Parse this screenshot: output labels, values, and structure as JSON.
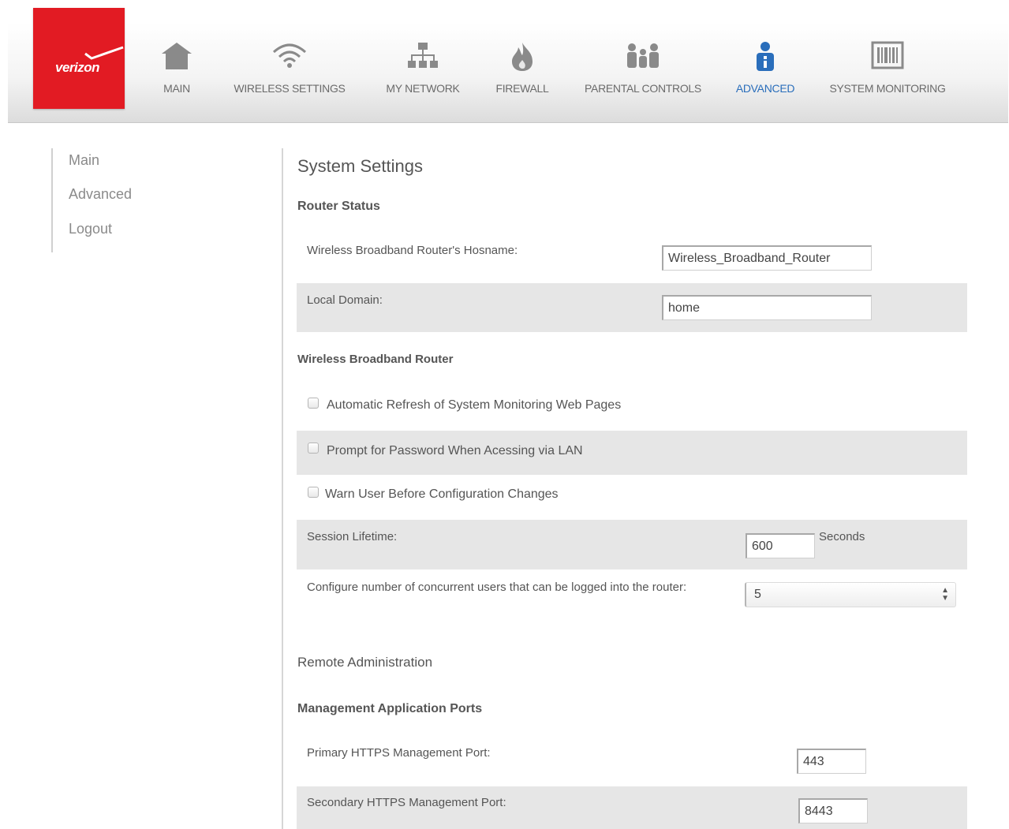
{
  "brand": {
    "logo_text": "verizon"
  },
  "nav": [
    {
      "label": "MAIN",
      "icon": "home-icon"
    },
    {
      "label": "WIRELESS SETTINGS",
      "icon": "wifi-icon"
    },
    {
      "label": "MY NETWORK",
      "icon": "network-icon"
    },
    {
      "label": "FIREWALL",
      "icon": "flame-icon"
    },
    {
      "label": "PARENTAL CONTROLS",
      "icon": "family-icon"
    },
    {
      "label": "ADVANCED",
      "icon": "advanced-user-icon",
      "active": true
    },
    {
      "label": "SYSTEM MONITORING",
      "icon": "monitor-icon"
    }
  ],
  "colors": {
    "brand_red": "#e21b23",
    "active_blue": "#2a6ebb"
  },
  "sidebar": {
    "items": [
      {
        "label": "Main"
      },
      {
        "label": "Advanced"
      },
      {
        "label": "Logout"
      }
    ]
  },
  "content": {
    "title": "System Settings",
    "router_status": {
      "heading": "Router Status",
      "hostname_label": "Wireless Broadband Router's Hosname:",
      "hostname_value": "Wireless_Broadband_Router",
      "domain_label": "Local Domain:",
      "domain_value": "home"
    },
    "wbr": {
      "heading": "Wireless Broadband Router",
      "auto_refresh_label": "Automatic Refresh of System Monitoring Web Pages",
      "prompt_password_label": "Prompt for Password When Acessing via LAN",
      "warn_user_label": "Warn User Before Configuration Changes",
      "session_label": "Session Lifetime:",
      "session_value": "600",
      "session_unit": "Seconds",
      "concurrent_label": "Configure number of concurrent users that can be logged into the router:",
      "concurrent_value": "5"
    },
    "remote_admin": {
      "heading": "Remote Administration"
    },
    "ports": {
      "heading": "Management Application Ports",
      "primary_label": "Primary HTTPS Management Port:",
      "primary_value": "443",
      "secondary_label": "Secondary HTTPS Management Port:",
      "secondary_value": "8443"
    }
  }
}
